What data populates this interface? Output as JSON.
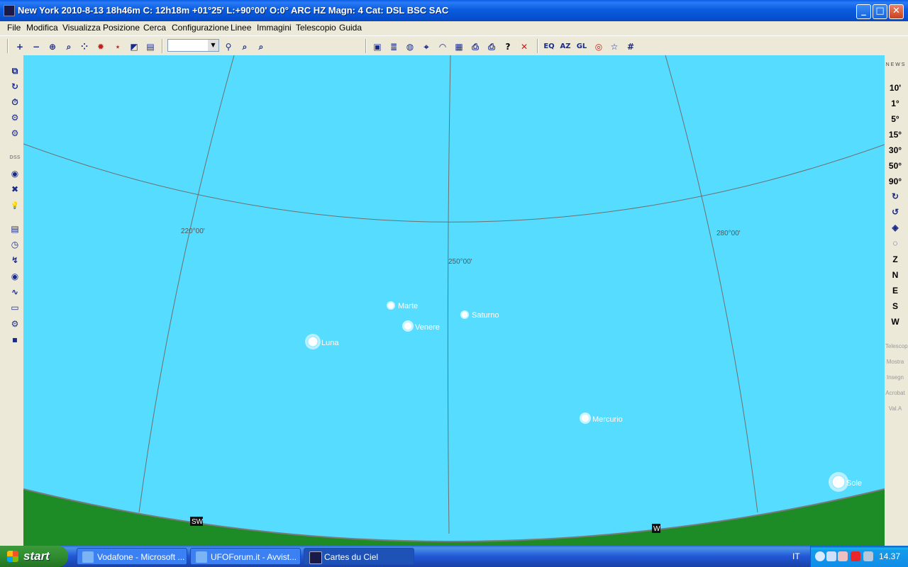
{
  "window": {
    "title": "New York 2010-8-13  18h46m C: 12h18m +01°25' L:+90°00' O:0°  ARC HZ  Magn: 4 Cat: DSL BSC SAC",
    "buttons": {
      "minimize": "_",
      "maximize": "□",
      "close": "✕"
    }
  },
  "menu": [
    "File",
    "Modifica",
    "Visualizza",
    "Posizione",
    "Cerca",
    "Configurazione",
    "Linee",
    "Immagini",
    "Telescopio",
    "Guida"
  ],
  "toolbar": {
    "zoom_in": "+",
    "zoom_out": "−",
    "zoom_fit": "⊕",
    "search": "⌕",
    "planets": "⁘",
    "sun": "✹",
    "stars": "⋆",
    "color": "◩",
    "page": "▤",
    "binocular": "⚲",
    "find": "⌕",
    "track": "⌕",
    "save": "▣",
    "notes": "≣",
    "globe": "◍",
    "telescope": "⌖",
    "dome": "◠",
    "calendar": "▦",
    "print": "⎙",
    "print_setup": "⎙",
    "help": "?",
    "exit": "✕",
    "eq": "EQ",
    "az": "AZ",
    "galactic": "GL",
    "target": "◎",
    "constellation": "☆",
    "grid": "#"
  },
  "combo": {
    "value": ""
  },
  "left_toolbar": [
    "⧉",
    "↻",
    "⏱",
    "⚙",
    "⚙",
    "DSS",
    "◉",
    "✖",
    "💡",
    "▤",
    "◷",
    "↯",
    "◉",
    "∿",
    "▭",
    "⚙",
    "▪"
  ],
  "right_toolbar": {
    "compass": "N E W S",
    "fields": [
      "10'",
      "1°",
      "5°",
      "15°",
      "30°",
      "50°",
      "90°"
    ],
    "rotate": [
      "↻",
      "↺",
      "◈",
      "◌"
    ],
    "directions": [
      "Z",
      "N",
      "E",
      "S",
      "W"
    ],
    "dim": [
      "Telescop",
      "Mostra",
      "Insegn",
      "Acrobat",
      "Val.A"
    ]
  },
  "chart": {
    "grid_labels": [
      "220°00'",
      "250°00'",
      "280°00'"
    ],
    "objects": [
      {
        "name": "Marte",
        "symbol": "planet"
      },
      {
        "name": "Saturno",
        "symbol": "planet"
      },
      {
        "name": "Venere",
        "symbol": "planet-bright"
      },
      {
        "name": "Luna",
        "symbol": "moon"
      },
      {
        "name": "Mercurio",
        "symbol": "planet-bright"
      },
      {
        "name": "Sole",
        "symbol": "sun"
      }
    ],
    "horizon_labels": [
      "SW",
      "W"
    ],
    "colors": {
      "sky": "#55dcff",
      "ground": "#1d8c27",
      "horizon": "#7a7a7a",
      "grid": "#6e6e6e"
    }
  },
  "taskbar": {
    "start_label": "start",
    "tasks": [
      {
        "label": "Vodafone - Microsoft ..."
      },
      {
        "label": "UFOForum.it - Avvist..."
      },
      {
        "label": "Cartes du Ciel"
      }
    ],
    "language": "IT",
    "clock": "14.37"
  }
}
